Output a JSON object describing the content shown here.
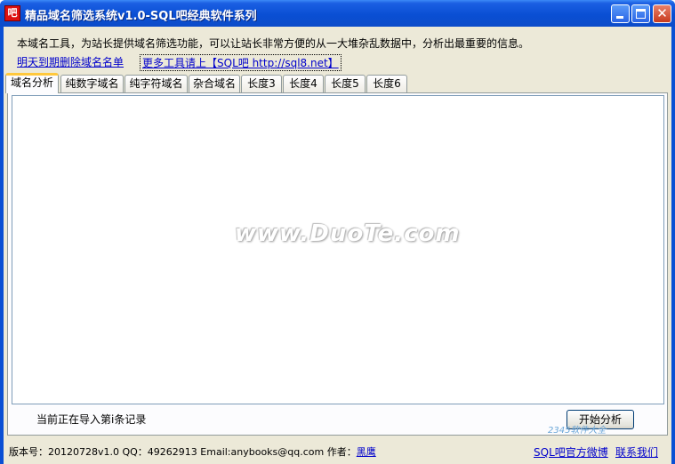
{
  "window": {
    "title": "精品域名筛选系统v1.0-SQL吧经典软件系列",
    "icon_text": "吧",
    "controls": [
      "minimize-icon",
      "maximize-icon",
      "close-icon"
    ]
  },
  "header": {
    "description": "本域名工具，为站长提供域名筛选功能，可以让站长非常方便的从一大堆杂乱数据中，分析出最重要的信息。",
    "link_deleted_domains": "明天到期删除域名名单",
    "link_more_tools": "更多工具请上【SQL吧 http://sql8.net】"
  },
  "tabs": [
    {
      "label": "域名分析",
      "active": true
    },
    {
      "label": "纯数字域名",
      "active": false
    },
    {
      "label": "纯字符域名",
      "active": false
    },
    {
      "label": "杂合域名",
      "active": false
    },
    {
      "label": "长度3",
      "active": false
    },
    {
      "label": "长度4",
      "active": false
    },
    {
      "label": "长度5",
      "active": false
    },
    {
      "label": "长度6",
      "active": false
    }
  ],
  "main": {
    "watermark": "www.DuoTe.com",
    "status_text": "当前正在导入第i条记录",
    "start_button": "开始分析"
  },
  "footer": {
    "version_info": "版本号：20120728v1.0 QQ：49262913  Email:anybooks@qq.com 作者：",
    "author": "黑鹰",
    "link_weibo": "SQL吧官方微博",
    "link_contact": "联系我们"
  },
  "corner_watermark": "2345软件大全"
}
